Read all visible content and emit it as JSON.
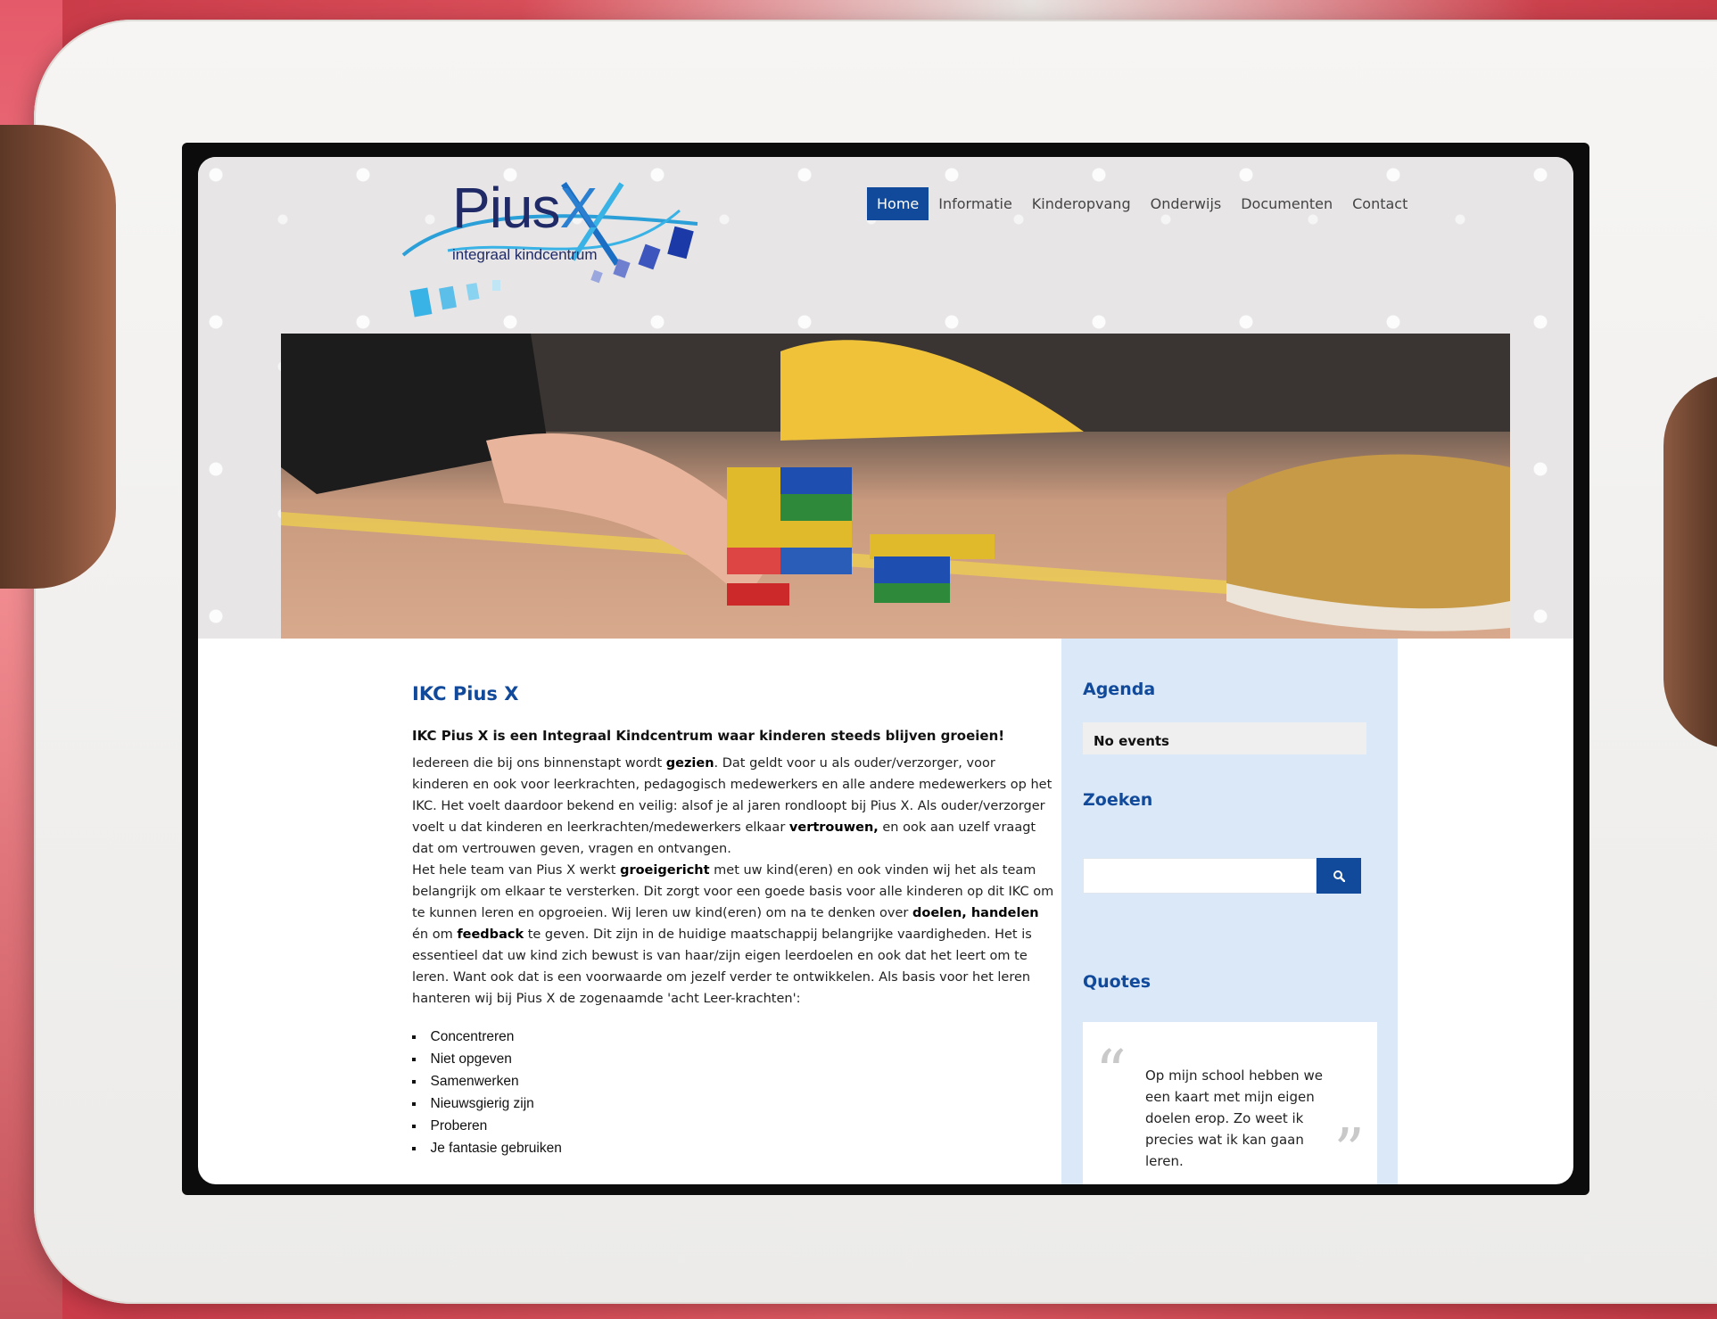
{
  "site": {
    "logo_main": "Pius",
    "logo_x": "X",
    "logo_sub": "integraal kindcentrum"
  },
  "nav": {
    "items": [
      {
        "label": "Home",
        "active": true
      },
      {
        "label": "Informatie",
        "active": false
      },
      {
        "label": "Kinderopvang",
        "active": false
      },
      {
        "label": "Onderwijs",
        "active": false
      },
      {
        "label": "Documenten",
        "active": false
      },
      {
        "label": "Contact",
        "active": false
      }
    ]
  },
  "main": {
    "title": "IKC Pius X",
    "lead": "IKC Pius X is een Integraal Kindcentrum waar kinderen  steeds blijven groeien!",
    "p1_a": "Iedereen die bij ons binnenstapt wordt ",
    "p1_b": "gezien",
    "p1_c": ". Dat geldt voor u als ouder/verzorger, voor kinderen en ook voor leerkrachten, pedagogisch medewerkers en alle andere medewerkers op het IKC. Het voelt daardoor bekend en veilig: alsof je al jaren rondloopt bij Pius X. Als ouder/verzorger voelt u dat kinderen en leerkrachten/medewerkers elkaar ",
    "p1_d": "vertrouwen,",
    "p1_e": " en ook aan uzelf vraagt dat om vertrouwen geven, vragen en ontvangen.",
    "p2_a": "Het hele team van Pius X werkt ",
    "p2_b": "groeigericht",
    "p2_c": " met uw kind(eren) en ook vinden wij het als team belangrijk om elkaar te versterken. Dit zorgt voor een goede basis voor alle kinderen op dit IKC om te kunnen leren en opgroeien. Wij leren uw kind(eren) om na te denken over ",
    "p2_d": "doelen, handelen",
    "p2_e": " én om ",
    "p2_f": "feedback",
    "p2_g": " te geven. Dit zijn in de huidige maatschappij belangrijke vaardigheden. Het is essentieel dat uw kind zich bewust is van haar/zijn eigen leerdoelen en ook dat het leert om te leren. Want ook dat is een voorwaarde om jezelf verder te ontwikkelen. Als basis voor het leren hanteren wij bij Pius X de zogenaamde 'acht Leer-krachten':",
    "bullets": [
      "Concentreren",
      "Niet opgeven",
      "Samenwerken",
      "Nieuwsgierig zijn",
      "Proberen",
      "Je fantasie gebruiken"
    ]
  },
  "sidebar": {
    "agenda_title": "Agenda",
    "agenda_empty": "No events",
    "search_title": "Zoeken",
    "search_placeholder": "",
    "quotes_title": "Quotes",
    "quote_text": "Op mijn school hebben we een kaart met mijn eigen doelen erop. Zo weet ik precies wat ik kan gaan leren."
  },
  "colors": {
    "brand_blue": "#114a9b",
    "sidebar_bg": "#dbe8f7"
  }
}
